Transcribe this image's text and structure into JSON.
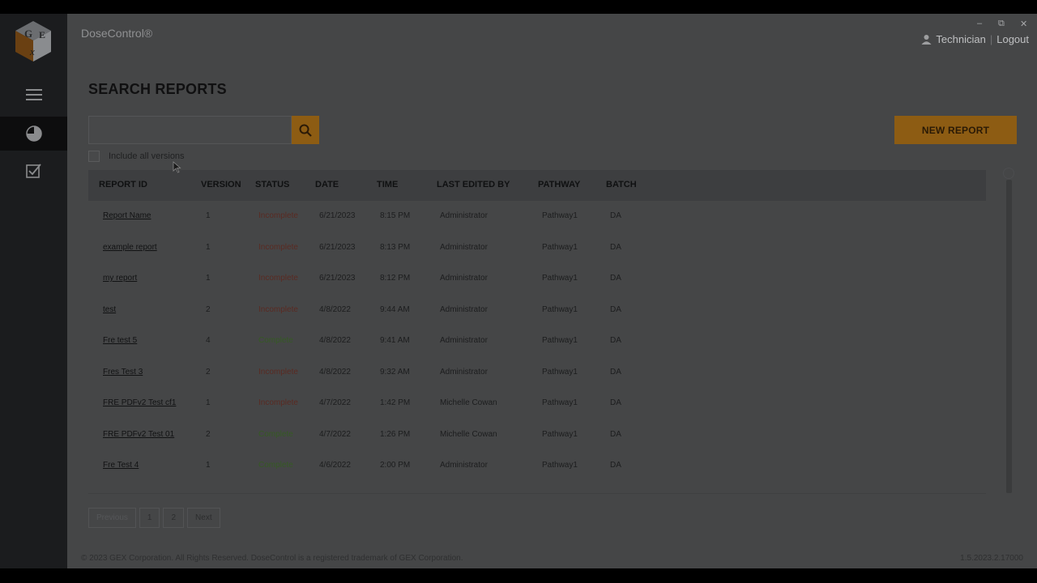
{
  "app": {
    "title": "DoseControl®"
  },
  "window": {
    "minimize": "–",
    "restore": "⧉",
    "close": "✕"
  },
  "user": {
    "name": "Technician",
    "separator": "|",
    "logout": "Logout"
  },
  "page": {
    "title": "SEARCH REPORTS"
  },
  "search": {
    "value": "",
    "placeholder": ""
  },
  "actions": {
    "new_report": "NEW REPORT"
  },
  "filters": {
    "include_all_versions": "Include all versions",
    "include_all_versions_checked": false
  },
  "table": {
    "columns": [
      "REPORT ID",
      "VERSION",
      "STATUS",
      "DATE",
      "TIME",
      "LAST EDITED BY",
      "PATHWAY",
      "BATCH"
    ],
    "rows": [
      {
        "id": "Report Name",
        "version": "1",
        "status": "Incomplete",
        "date": "6/21/2023",
        "time": "8:15 PM",
        "editor": "Administrator",
        "pathway": "Pathway1",
        "batch": "DA"
      },
      {
        "id": "example report",
        "version": "1",
        "status": "Incomplete",
        "date": "6/21/2023",
        "time": "8:13 PM",
        "editor": "Administrator",
        "pathway": "Pathway1",
        "batch": "DA"
      },
      {
        "id": "my report",
        "version": "1",
        "status": "Incomplete",
        "date": "6/21/2023",
        "time": "8:12 PM",
        "editor": "Administrator",
        "pathway": "Pathway1",
        "batch": "DA"
      },
      {
        "id": "test",
        "version": "2",
        "status": "Incomplete",
        "date": "4/8/2022",
        "time": "9:44 AM",
        "editor": "Administrator",
        "pathway": "Pathway1",
        "batch": "DA"
      },
      {
        "id": "Fre test 5",
        "version": "4",
        "status": "Complete",
        "date": "4/8/2022",
        "time": "9:41 AM",
        "editor": "Administrator",
        "pathway": "Pathway1",
        "batch": "DA"
      },
      {
        "id": "Fres Test 3",
        "version": "2",
        "status": "Incomplete",
        "date": "4/8/2022",
        "time": "9:32 AM",
        "editor": "Administrator",
        "pathway": "Pathway1",
        "batch": "DA"
      },
      {
        "id": "FRE PDFv2 Test cf1",
        "version": "1",
        "status": "Incomplete",
        "date": "4/7/2022",
        "time": "1:42 PM",
        "editor": "Michelle Cowan",
        "pathway": "Pathway1",
        "batch": "DA"
      },
      {
        "id": "FRE PDFv2 Test 01",
        "version": "2",
        "status": "Complete",
        "date": "4/7/2022",
        "time": "1:26 PM",
        "editor": "Michelle Cowan",
        "pathway": "Pathway1",
        "batch": "DA"
      },
      {
        "id": "Fre Test 4",
        "version": "1",
        "status": "Complete",
        "date": "4/6/2022",
        "time": "2:00 PM",
        "editor": "Administrator",
        "pathway": "Pathway1",
        "batch": "DA"
      }
    ]
  },
  "pagination": {
    "previous": "Previous",
    "pages": [
      "1",
      "2"
    ],
    "next": "Next"
  },
  "footer": {
    "copyright": "© 2023 GEX Corporation. All Rights Reserved. DoseControl is a registered trademark of GEX Corporation.",
    "version": "1.5.2023.2.17000"
  },
  "colors": {
    "accent": "#8d5c13",
    "sidebar": "#1b1c1e",
    "main_bg": "#454647",
    "incomplete": "#5a2a22",
    "complete": "#355a23"
  },
  "icons": {
    "logo": "gex-cube-logo",
    "menu": "hamburger-icon",
    "dashboard": "pie-chart-icon",
    "tasks": "checkbox-icon",
    "search": "search-icon",
    "user": "user-icon"
  }
}
